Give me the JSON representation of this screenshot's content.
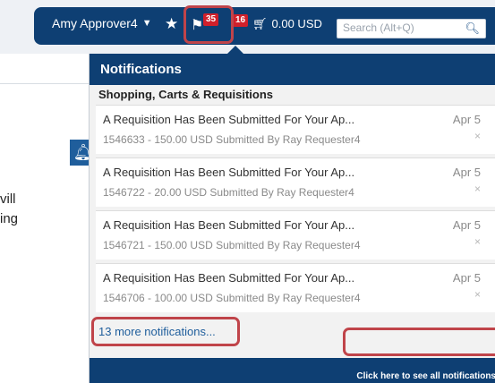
{
  "navbar": {
    "user_name": "Amy Approver4",
    "user_caret": "▼",
    "favorites_icon": "star-icon",
    "flag_icon": "flag-icon",
    "flag_count": "35",
    "message_count": "16",
    "cart_icon": "cart-icon",
    "cart_total": "0.00 USD",
    "search_placeholder": "Search (Alt+Q)",
    "search_icon": "search-icon"
  },
  "background_page": {
    "line1": "vill",
    "line2": "ing"
  },
  "notifications": {
    "header": "Notifications",
    "section": "Shopping, Carts & Requisitions",
    "items": [
      {
        "title": "A Requisition Has Been Submitted For Your Ap...",
        "subtitle": "1546633 - 150.00 USD Submitted By Ray Requester4",
        "date": "Apr 5",
        "close": "×"
      },
      {
        "title": "A Requisition Has Been Submitted For Your Ap...",
        "subtitle": "1546722 - 20.00 USD Submitted By Ray Requester4",
        "date": "Apr 5",
        "close": "×"
      },
      {
        "title": "A Requisition Has Been Submitted For Your Ap...",
        "subtitle": "1546721 - 150.00 USD Submitted By Ray Requester4",
        "date": "Apr 5",
        "close": "×"
      },
      {
        "title": "A Requisition Has Been Submitted For Your Ap...",
        "subtitle": "1546706 - 100.00 USD Submitted By Ray Requester4",
        "date": "Apr 5",
        "close": "×"
      }
    ],
    "more_link": "13 more notifications...",
    "footer_link": "Click here to see all notifications"
  },
  "colors": {
    "navbar": "#0e3f73",
    "badge": "#d0202b",
    "highlight": "#c0444a",
    "link": "#1f5e9c"
  }
}
